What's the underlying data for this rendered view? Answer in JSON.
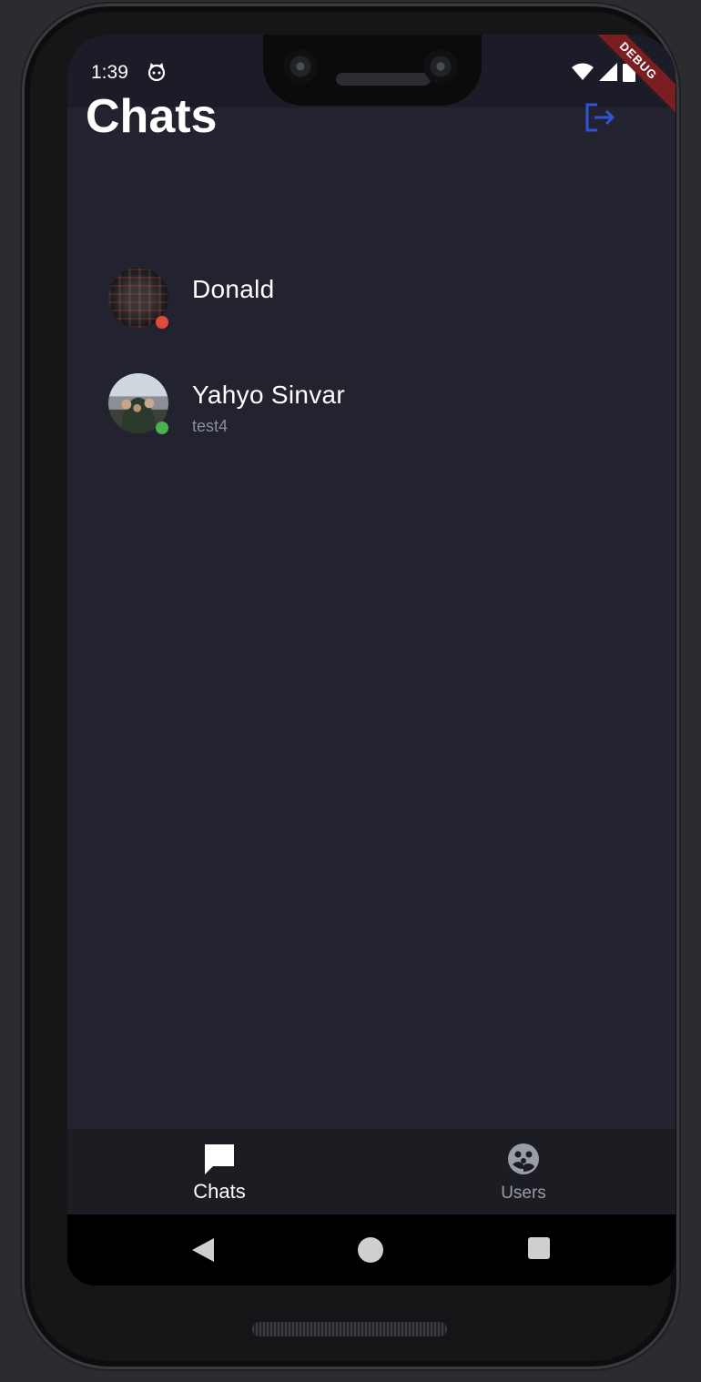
{
  "status_bar": {
    "time": "1:39",
    "icons": [
      "notification-cat-icon",
      "wifi-icon",
      "cell-signal-icon",
      "battery-icon"
    ]
  },
  "debug_banner": "DEBUG",
  "header": {
    "title": "Chats",
    "logout_icon": "logout-icon",
    "accent_color": "#2f54d6"
  },
  "chats": [
    {
      "name": "Donald",
      "preview": "",
      "status": "offline",
      "status_color": "#e24b3b"
    },
    {
      "name": "Yahyo Sinvar",
      "preview": "test4",
      "status": "online",
      "status_color": "#4caf50"
    }
  ],
  "bottom_nav": {
    "items": [
      {
        "label": "Chats",
        "icon": "chat-bubble-icon",
        "active": true
      },
      {
        "label": "Users",
        "icon": "users-group-icon",
        "active": false
      }
    ]
  },
  "system_nav": [
    "back-icon",
    "home-icon",
    "recents-icon"
  ]
}
